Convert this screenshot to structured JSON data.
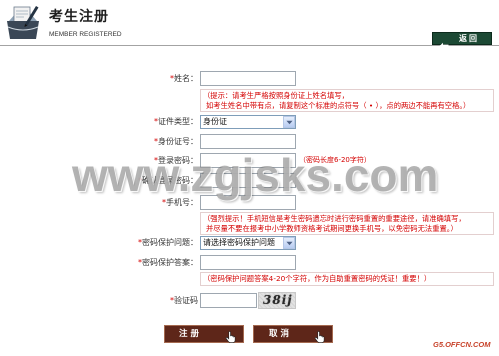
{
  "header": {
    "title": "考生注册",
    "subtitle": "MEMBER REGISTERED",
    "back_label": "返回"
  },
  "form": {
    "required_mark": "*",
    "name": {
      "label": "姓名：",
      "value": ""
    },
    "name_hint": {
      "line1": "（提示：请考生严格按照身份证上姓名填写，",
      "line2": "如考生姓名中带有点，请复制这个标准的点符号（ • ），点的两边不能再有空格。）"
    },
    "id_type": {
      "label": "证件类型：",
      "selected": "身份证"
    },
    "id_number": {
      "label": "身份证号：",
      "value": ""
    },
    "password": {
      "label": "登录密码：",
      "value": "",
      "hint": "（密码长度6-20字符）"
    },
    "confirm_password": {
      "label": "确认登录密码：",
      "value": ""
    },
    "mobile": {
      "label": "手机号：",
      "value": ""
    },
    "mobile_hint": {
      "line1": "（强烈提示！手机短信是考生密码遗忘时进行密码重置的重要途径，请准确填写，",
      "line2": "并尽量不要在报考中小学教师资格考试期间更换手机号，以免密码无法重置。）"
    },
    "security_question": {
      "label": "密码保护问题：",
      "selected": "请选择密码保护问题"
    },
    "security_answer": {
      "label": "密码保护答案：",
      "value": ""
    },
    "answer_hint": "（密码保护问题答案4-20个字符，作为自助重置密码的凭证！重要！）",
    "captcha": {
      "label": "验证码",
      "value": "",
      "image_text": "38ij"
    }
  },
  "actions": {
    "submit_label": "注 册",
    "cancel_label": "取 消"
  },
  "watermarks": {
    "site": "www.zgjsks.com",
    "corner": "G5.OFFCN.COM"
  },
  "icons": {
    "logo": "registration-folder-icon",
    "back": "arrow-left-icon",
    "select": "chevron-down-icon",
    "button_cursor": "hand-pointer-icon"
  },
  "colors": {
    "hint_text": "#d40000",
    "back_button": "#1c4934",
    "action_button": "#5e2619",
    "watermark_corner": "#c8432b"
  }
}
